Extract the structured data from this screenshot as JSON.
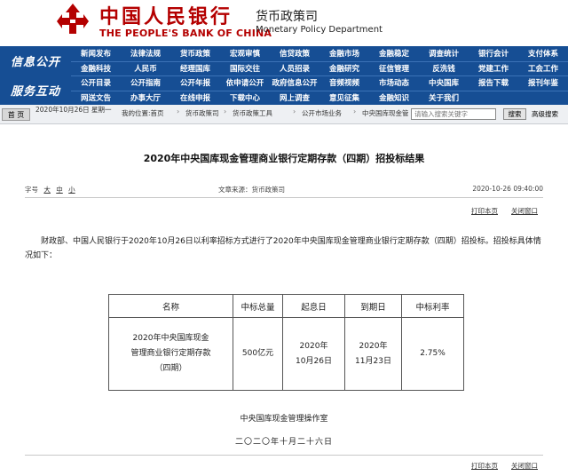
{
  "header": {
    "logo_cn": "中国人民银行",
    "logo_en": "THE PEOPLE'S BANK OF CHINA",
    "dept_cn": "货币政策司",
    "dept_en": "Monetary Policy Department",
    "brand_color": "#b40000"
  },
  "nav": {
    "label_1": "信息公开",
    "label_2": "服务互动",
    "color": "#164e94",
    "rows": [
      [
        "新闻发布",
        "法律法规",
        "货币政策",
        "宏观审慎",
        "信贷政策",
        "金融市场",
        "金融稳定",
        "调查统计",
        "银行会计",
        "支付体系"
      ],
      [
        "金融科技",
        "人民币",
        "经理国库",
        "国际交往",
        "人员招录",
        "金融研究",
        "征信管理",
        "反洗钱",
        "党建工作",
        "工会工作"
      ],
      [
        "公开目录",
        "公开指南",
        "公开年报",
        "依申请公开",
        "政府信息公开",
        "音频视频",
        "市场动态",
        "中央国库",
        "报告下载",
        "报刊年鉴"
      ],
      [
        "网送文告",
        "办事大厅",
        "在线申报",
        "下载中心",
        "网上调查",
        "意见征集",
        "金融知识",
        "关于我们"
      ]
    ]
  },
  "breadcrumb": {
    "home": "首 页",
    "date": "2020年10月26日 星期一",
    "items": [
      "我的位置:首页",
      "货币政策司",
      "货币政策工具",
      "公开市场业务",
      "中央国库现金管理业务公告"
    ],
    "search_placeholder": "请输入搜索关键字",
    "search_button": "搜索",
    "advanced": "高级搜索"
  },
  "article": {
    "title": "2020年中央国库现金管理商业银行定期存款（四期）招投标结果",
    "font_label": "字号",
    "font_sizes": [
      "大",
      "中",
      "小"
    ],
    "source": "文章来源：货币政策司",
    "pubdate": "2020-10-26 09:40:00",
    "print": "打印本页",
    "close": "关闭窗口",
    "paragraph": "财政部、中国人民银行于2020年10月26日以利率招标方式进行了2020年中央国库现金管理商业银行定期存款（四期）招投标。招投标具体情况如下：",
    "table": {
      "headers": [
        "名称",
        "中标总量",
        "起息日",
        "到期日",
        "中标利率"
      ],
      "row": {
        "name": [
          "2020年中央国库现金",
          "管理商业银行定期存款",
          "（四期）"
        ],
        "amount": "500亿元",
        "start": [
          "2020年",
          "10月26日"
        ],
        "end": [
          "2020年",
          "11月23日"
        ],
        "rate": "2.75%"
      }
    },
    "signature": "中央国库现金管理操作室",
    "sign_date": "二〇二〇年十月二十六日"
  }
}
